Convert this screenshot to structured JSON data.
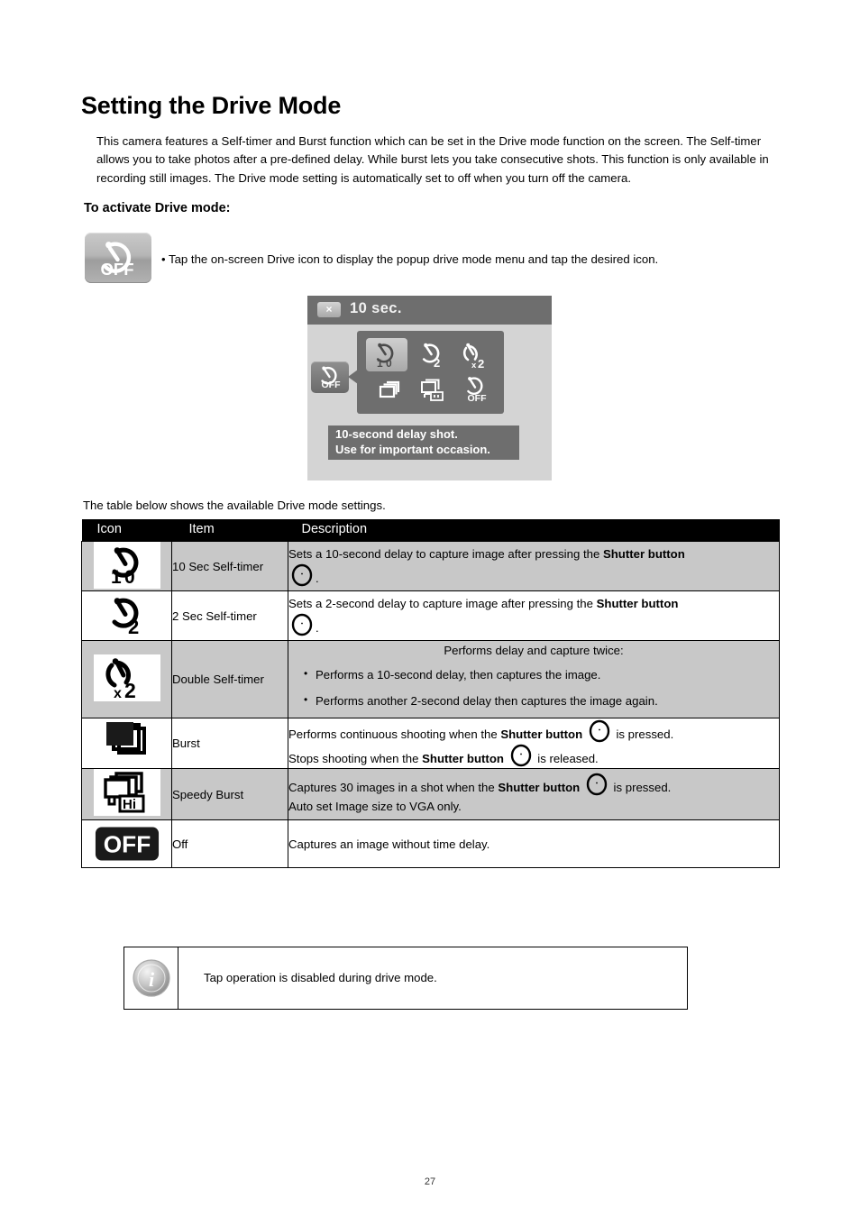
{
  "document": {
    "title": "Setting the Drive Mode",
    "intro": "This camera features a Self-timer and Burst function which can be set in the Drive mode function on the screen. The Self-timer allows you to take photos after a pre-defined delay. While burst lets you take consecutive shots. This function is only available in recording still images. The Drive mode setting is automatically set to off when you turn off the camera.",
    "page_number": "27"
  },
  "activate_section": {
    "heading": "To activate Drive mode:",
    "bullet": "Tap the on-screen Drive icon to display the popup drive mode menu and tap the desired icon.",
    "bullet_marker": "•",
    "drive_icon_name": "drive-off-icon"
  },
  "camera_mockup": {
    "close_label": "×",
    "title": "10 sec.",
    "menu_icons": [
      "self-timer-10sec-icon",
      "self-timer-2sec-icon",
      "self-timer-double-icon",
      "burst-icon",
      "speedy-burst-icon",
      "drive-off-icon"
    ],
    "selected_index": 0,
    "left_button_icon": "drive-off-icon",
    "tooltip_line1": "10-second delay shot.",
    "tooltip_line2": "Use for important occasion."
  },
  "table_intro": "The table below shows the available Drive mode settings.",
  "table": {
    "headers": [
      "Icon",
      "Item",
      "Description"
    ],
    "rows": [
      {
        "icon": "self-timer-10sec-icon",
        "item": "10 Sec Self-timer",
        "desc_pre": "Sets a 10-second delay to capture image after pressing the ",
        "desc_bold": "Shutter button",
        "desc_post": "."
      },
      {
        "icon": "self-timer-2sec-icon",
        "item": "2 Sec Self-timer",
        "desc_pre": "Sets a 2-second delay to capture image after pressing the ",
        "desc_bold": "Shutter button",
        "desc_post": "."
      },
      {
        "icon": "self-timer-double-icon",
        "item": "Double Self-timer",
        "desc_title": "Performs delay and capture twice:",
        "desc_bullets": [
          "Performs a 10-second delay, then captures the image.",
          "Performs another 2-second delay then captures the image again."
        ]
      },
      {
        "icon": "burst-icon",
        "item": "Burst",
        "line1_pre": "Performs continuous shooting when the ",
        "line1_bold": "Shutter button",
        "line1_post": " is pressed.",
        "line2_pre": "Stops shooting when the ",
        "line2_bold": "Shutter button",
        "line2_post": " is released."
      },
      {
        "icon": "speedy-burst-icon",
        "item": "Speedy Burst",
        "line1_pre": "Captures 30 images in a shot when the ",
        "line1_bold": "Shutter button",
        "line1_post": " is pressed.",
        "line2": "Auto set Image size to VGA only."
      },
      {
        "icon": "drive-off-badge-icon",
        "item": "Off",
        "desc_plain": "Captures an image without time delay."
      }
    ]
  },
  "note": {
    "icon": "info-icon",
    "text": "Tap operation is disabled during drive mode."
  },
  "colors": {
    "header_bg": "#000000",
    "shaded_row": "#c8c8c8",
    "mockup_bg": "#d4d4d4",
    "mockup_panel": "#6e6e6e"
  }
}
